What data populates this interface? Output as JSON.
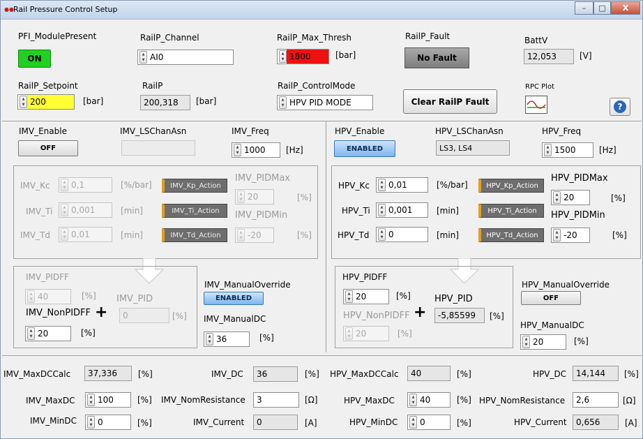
{
  "window": {
    "title": "Rail Pressure Control Setup",
    "min_label": "–",
    "max_label": "□",
    "close_label": "X"
  },
  "top": {
    "pfi_label": "PFI_ModulePresent",
    "pfi_value": "ON",
    "railp_channel_label": "RailP_Channel",
    "railp_channel_value": "AI0",
    "railp_max_label": "RailP_Max_Thresh",
    "railp_max_value": "1800",
    "railp_max_unit": "[bar]",
    "railp_fault_label": "RailP_Fault",
    "railp_fault_value": "No Fault",
    "battv_label": "BattV",
    "battv_value": "12,053",
    "battv_unit": "[V]",
    "setpoint_label": "RailP_Setpoint",
    "setpoint_value": "200",
    "setpoint_unit": "[bar]",
    "railp_label": "RailP",
    "railp_value": "200,318",
    "railp_unit": "[bar]",
    "control_mode_label": "RailP_ControlMode",
    "control_mode_value": "HPV PID MODE",
    "clear_fault_label": "Clear RailP Fault",
    "rpc_plot_label": "RPC Plot",
    "help_icon": "help-icon",
    "colors": {
      "on_green": "#22d022",
      "max_thresh_red": "#ee1111",
      "setpoint_yellow": "#ffff33"
    }
  },
  "imv": {
    "enable_label": "IMV_Enable",
    "enable_value": "OFF",
    "lschan_label": "IMV_LSChanAsn",
    "lschan_value": "",
    "freq_label": "IMV_Freq",
    "freq_value": "1000",
    "freq_unit": "[Hz]",
    "kc_label": "IMV_Kc",
    "kc_value": "0,1",
    "kc_unit": "[%/bar]",
    "ti_label": "IMV_Ti",
    "ti_value": "0,001",
    "ti_unit": "[min]",
    "td_label": "IMV_Td",
    "td_value": "0,01",
    "td_unit": "[min]",
    "kp_action": "IMV_Kp_Action",
    "ti_action": "IMV_Ti_Action",
    "td_action": "IMV_Td_Action",
    "pidmax_label": "IMV_PIDMax",
    "pidmax_value": "20",
    "pidmax_unit": "[%]",
    "pidmin_label": "IMV_PIDMin",
    "pidmin_value": "-20",
    "pidmin_unit": "[%]",
    "pidff_label": "IMV_PIDFF",
    "pidff_value": "40",
    "pidff_unit": "[%]",
    "pid_label": "IMV_PID",
    "pid_value": "0",
    "pid_unit": "[%]",
    "nonpidff_label": "IMV_NonPIDFF",
    "nonpidff_value": "20",
    "nonpidff_unit": "[%]",
    "manual_override_label": "IMV_ManualOverride",
    "manual_override_value": "ENABLED",
    "manual_dc_label": "IMV_ManualDC",
    "manual_dc_value": "36",
    "manual_dc_unit": "[%]",
    "maxdccalc_label": "IMV_MaxDCCalc",
    "maxdccalc_value": "37,336",
    "maxdccalc_unit": "[%]",
    "maxdc_label": "IMV_MaxDC",
    "maxdc_value": "100",
    "maxdc_unit": "[%]",
    "mindc_label": "IMV_MinDC",
    "mindc_value": "0",
    "mindc_unit": "[%]",
    "dc_label": "IMV_DC",
    "dc_value": "36",
    "dc_unit": "[%]",
    "nomres_label": "IMV_NomResistance",
    "nomres_value": "3",
    "nomres_unit": "[Ω]",
    "current_label": "IMV_Current",
    "current_value": "0",
    "current_unit": "[A]"
  },
  "hpv": {
    "enable_label": "HPV_Enable",
    "enable_value": "ENABLED",
    "lschan_label": "HPV_LSChanAsn",
    "lschan_value": "LS3, LS4",
    "freq_label": "HPV_Freq",
    "freq_value": "1500",
    "freq_unit": "[Hz]",
    "kc_label": "HPV_Kc",
    "kc_value": "0,01",
    "kc_unit": "[%/bar]",
    "ti_label": "HPV_Ti",
    "ti_value": "0,001",
    "ti_unit": "[min]",
    "td_label": "HPV_Td",
    "td_value": "0",
    "td_unit": "[min]",
    "kp_action": "HPV_Kp_Action",
    "ti_action": "HPV_Ti_Action",
    "td_action": "HPV_Td_Action",
    "pidmax_label": "HPV_PIDMax",
    "pidmax_value": "20",
    "pidmax_unit": "[%]",
    "pidmin_label": "HPV_PIDMin",
    "pidmin_value": "-20",
    "pidmin_unit": "[%]",
    "pidff_label": "HPV_PIDFF",
    "pidff_value": "20",
    "pidff_unit": "[%]",
    "pid_label": "HPV_PID",
    "pid_value": "-5,85599",
    "pid_unit": "[%]",
    "nonpidff_label": "HPV_NonPIDFF",
    "nonpidff_value": "20",
    "nonpidff_unit": "[%]",
    "manual_override_label": "HPV_ManualOverride",
    "manual_override_value": "OFF",
    "manual_dc_label": "HPV_ManualDC",
    "manual_dc_value": "20",
    "manual_dc_unit": "[%]",
    "maxdccalc_label": "HPV_MaxDCCalc",
    "maxdccalc_value": "40",
    "maxdccalc_unit": "[%]",
    "maxdc_label": "HPV_MaxDC",
    "maxdc_value": "40",
    "maxdc_unit": "[%]",
    "mindc_label": "HPV_MinDC",
    "mindc_value": "0",
    "mindc_unit": "[%]",
    "dc_label": "HPV_DC",
    "dc_value": "14,144",
    "dc_unit": "[%]",
    "nomres_label": "HPV_NomResistance",
    "nomres_value": "2,6",
    "nomres_unit": "[Ω]",
    "current_label": "HPV_Current",
    "current_value": "0,656",
    "current_unit": "[A]"
  },
  "symbols": {
    "plus": "+"
  }
}
